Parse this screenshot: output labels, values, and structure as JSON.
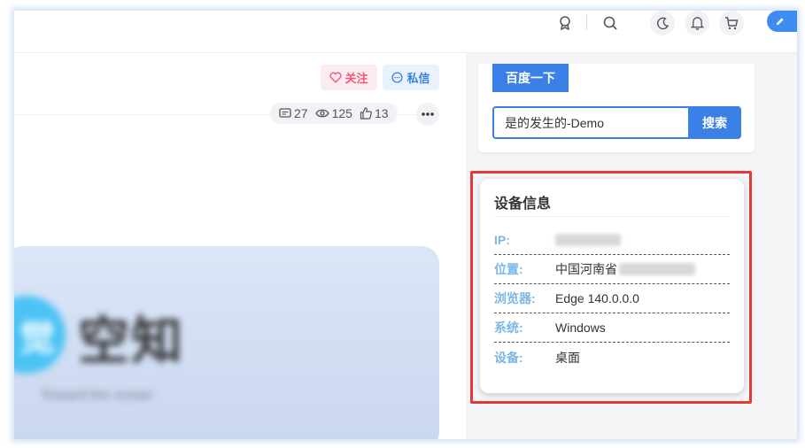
{
  "header": {
    "icons": [
      "award-icon",
      "search-icon",
      "moon-icon",
      "bell-icon",
      "cart-icon",
      "pencil-icon"
    ]
  },
  "article": {
    "follow_label": "关注",
    "message_label": "私信",
    "stats": {
      "comments": "27",
      "views": "125",
      "likes": "13"
    },
    "banner": {
      "logo_char": "觉",
      "title": "空知",
      "subtitle": "Toward the ocean"
    }
  },
  "search": {
    "tab_label": "百度一下",
    "input_value": "是的发生的-Demo",
    "button_label": "搜索"
  },
  "device_info": {
    "title": "设备信息",
    "rows": [
      {
        "label": "IP:",
        "value": ""
      },
      {
        "label": "位置:",
        "value": "中国河南省"
      },
      {
        "label": "浏览器:",
        "value": "Edge 140.0.0.0"
      },
      {
        "label": "系统:",
        "value": "Windows"
      },
      {
        "label": "设备:",
        "value": "桌面"
      }
    ]
  },
  "colors": {
    "accent": "#3a80e6",
    "follow": "#f05a78",
    "label": "#7ab6e6",
    "highlight": "#e53935"
  }
}
